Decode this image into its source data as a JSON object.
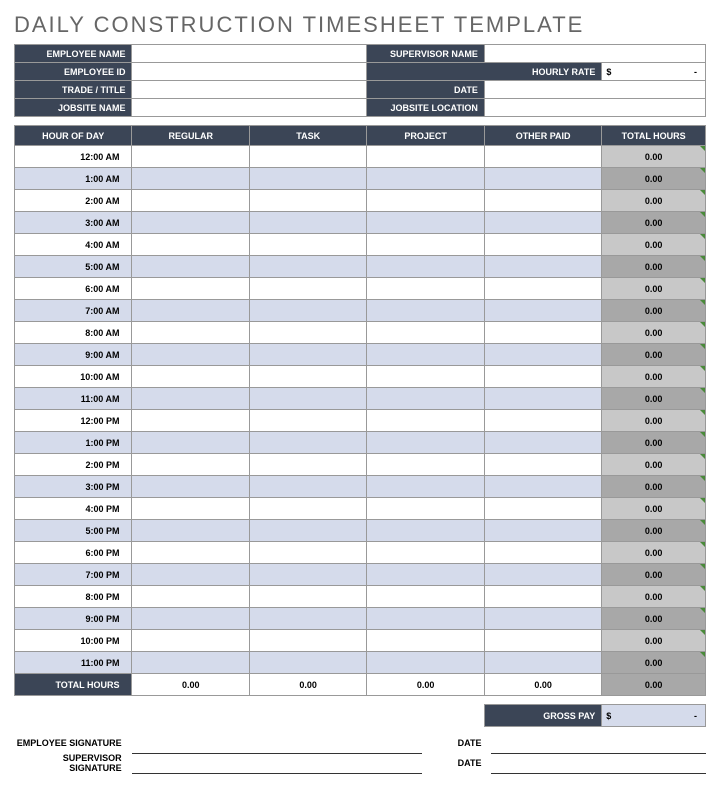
{
  "title": "DAILY CONSTRUCTION TIMESHEET TEMPLATE",
  "info": {
    "employee_name_lbl": "EMPLOYEE NAME",
    "supervisor_name_lbl": "SUPERVISOR NAME",
    "employee_id_lbl": "EMPLOYEE ID",
    "hourly_rate_lbl": "HOURLY RATE",
    "hourly_rate_sym": "$",
    "hourly_rate_val": "-",
    "trade_title_lbl": "TRADE / TITLE",
    "date_lbl": "DATE",
    "jobsite_name_lbl": "JOBSITE NAME",
    "jobsite_location_lbl": "JOBSITE LOCATION"
  },
  "cols": {
    "hour": "HOUR OF DAY",
    "regular": "REGULAR",
    "task": "TASK",
    "project": "PROJECT",
    "other": "OTHER PAID",
    "total": "TOTAL HOURS"
  },
  "hours": [
    {
      "h": "12:00 AM",
      "t": "0.00"
    },
    {
      "h": "1:00 AM",
      "t": "0.00"
    },
    {
      "h": "2:00 AM",
      "t": "0.00"
    },
    {
      "h": "3:00 AM",
      "t": "0.00"
    },
    {
      "h": "4:00 AM",
      "t": "0.00"
    },
    {
      "h": "5:00 AM",
      "t": "0.00"
    },
    {
      "h": "6:00 AM",
      "t": "0.00"
    },
    {
      "h": "7:00 AM",
      "t": "0.00"
    },
    {
      "h": "8:00 AM",
      "t": "0.00"
    },
    {
      "h": "9:00 AM",
      "t": "0.00"
    },
    {
      "h": "10:00 AM",
      "t": "0.00"
    },
    {
      "h": "11:00 AM",
      "t": "0.00"
    },
    {
      "h": "12:00 PM",
      "t": "0.00"
    },
    {
      "h": "1:00 PM",
      "t": "0.00"
    },
    {
      "h": "2:00 PM",
      "t": "0.00"
    },
    {
      "h": "3:00 PM",
      "t": "0.00"
    },
    {
      "h": "4:00 PM",
      "t": "0.00"
    },
    {
      "h": "5:00 PM",
      "t": "0.00"
    },
    {
      "h": "6:00 PM",
      "t": "0.00"
    },
    {
      "h": "7:00 PM",
      "t": "0.00"
    },
    {
      "h": "8:00 PM",
      "t": "0.00"
    },
    {
      "h": "9:00 PM",
      "t": "0.00"
    },
    {
      "h": "10:00 PM",
      "t": "0.00"
    },
    {
      "h": "11:00 PM",
      "t": "0.00"
    }
  ],
  "totals": {
    "label": "TOTAL HOURS",
    "regular": "0.00",
    "task": "0.00",
    "project": "0.00",
    "other": "0.00",
    "total": "0.00"
  },
  "gross": {
    "label": "GROSS PAY",
    "sym": "$",
    "val": "-"
  },
  "sig": {
    "emp_lbl": "EMPLOYEE SIGNATURE",
    "sup_lbl": "SUPERVISOR SIGNATURE",
    "date_lbl": "DATE"
  }
}
